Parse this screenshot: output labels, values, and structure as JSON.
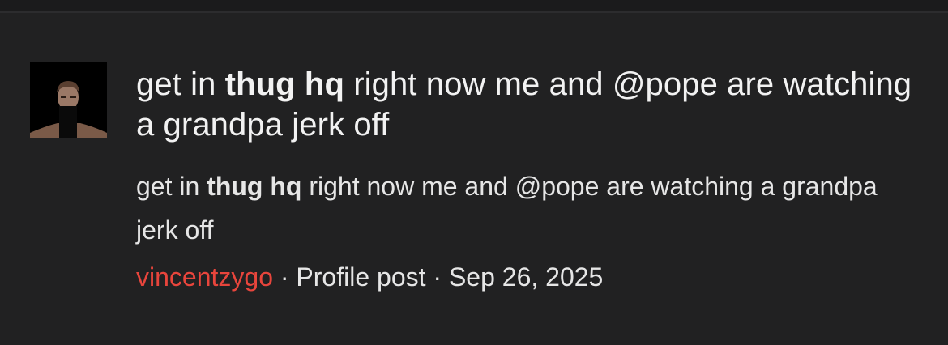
{
  "post": {
    "title_pre": "get in ",
    "title_bold": "thug hq",
    "title_post": " right now me and @pope are watching a grandpa jerk off",
    "snippet_pre": "get in ",
    "snippet_bold": "thug hq",
    "snippet_post": " right now me and @pope are watching a grandpa jerk off",
    "author": "vincentzygo",
    "separator": " · ",
    "type": "Profile post",
    "date": "Sep 26, 2025"
  },
  "colors": {
    "background": "#212122",
    "author_link": "#e8453c",
    "text": "#f2f2f2"
  }
}
